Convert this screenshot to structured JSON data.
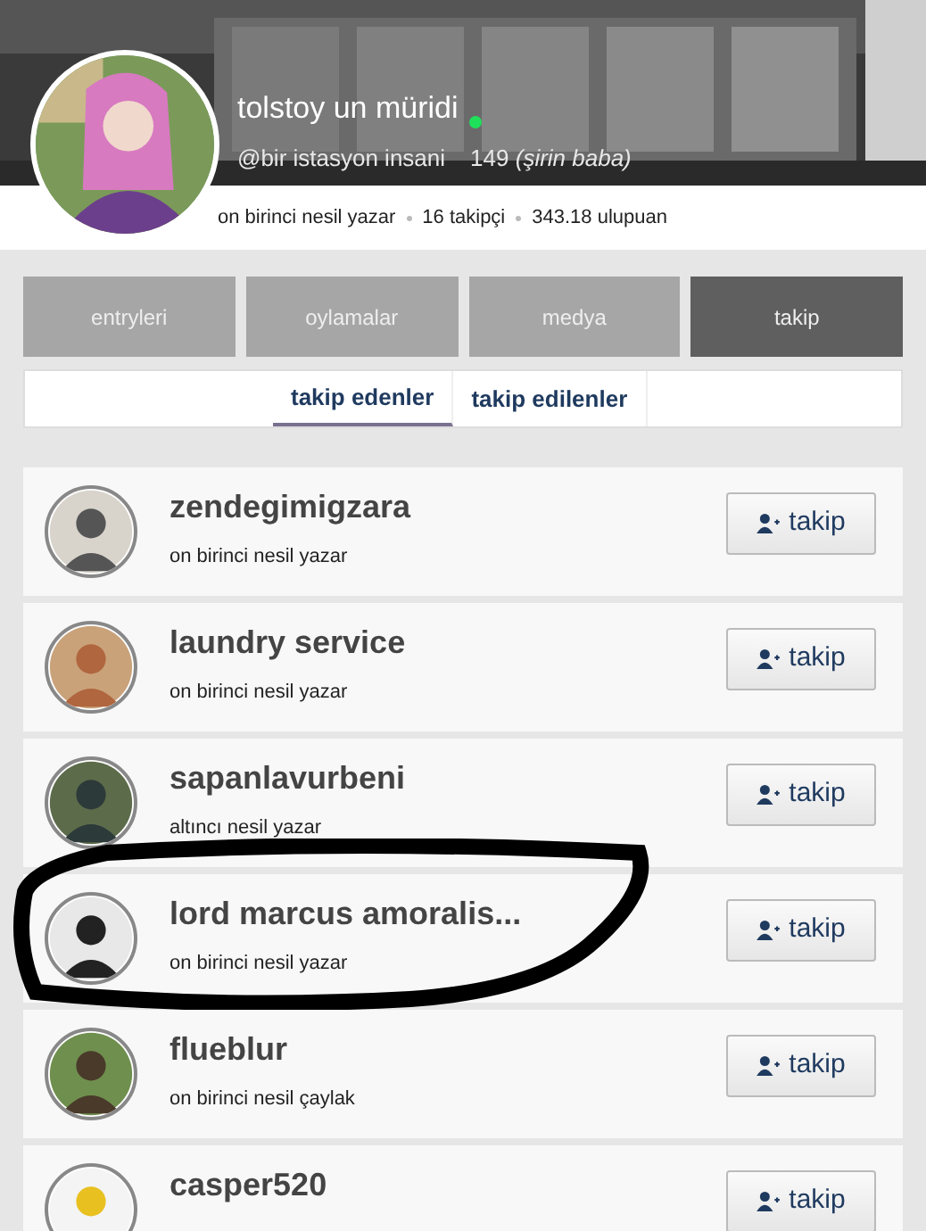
{
  "profile": {
    "name": "tolstoy un müridi",
    "online": true,
    "handle": "@bir istasyon insani",
    "count": "149",
    "count_note": "(şirin baba)",
    "rank": "on birinci nesil yazar",
    "followers": "16 takipçi",
    "points": "343.18 ulupuan"
  },
  "tabs": [
    {
      "label": "entryleri",
      "selected": false
    },
    {
      "label": "oylamalar",
      "selected": false
    },
    {
      "label": "medya",
      "selected": false
    },
    {
      "label": "takip",
      "selected": true
    }
  ],
  "subtabs": [
    {
      "label": "takip edenler",
      "selected": true
    },
    {
      "label": "takip edilenler",
      "selected": false
    }
  ],
  "users": [
    {
      "name": "zendegimigzara",
      "rank": "on birinci nesil yazar",
      "button": "takip"
    },
    {
      "name": "laundry service",
      "rank": "on birinci nesil yazar",
      "button": "takip"
    },
    {
      "name": "sapanlavurbeni",
      "rank": "altıncı nesil yazar",
      "button": "takip"
    },
    {
      "name": "lord marcus amoralis...",
      "rank": "on birinci nesil yazar",
      "button": "takip"
    },
    {
      "name": "flueblur",
      "rank": "on birinci nesil çaylak",
      "button": "takip"
    },
    {
      "name": "casper520",
      "button": "takip"
    }
  ]
}
